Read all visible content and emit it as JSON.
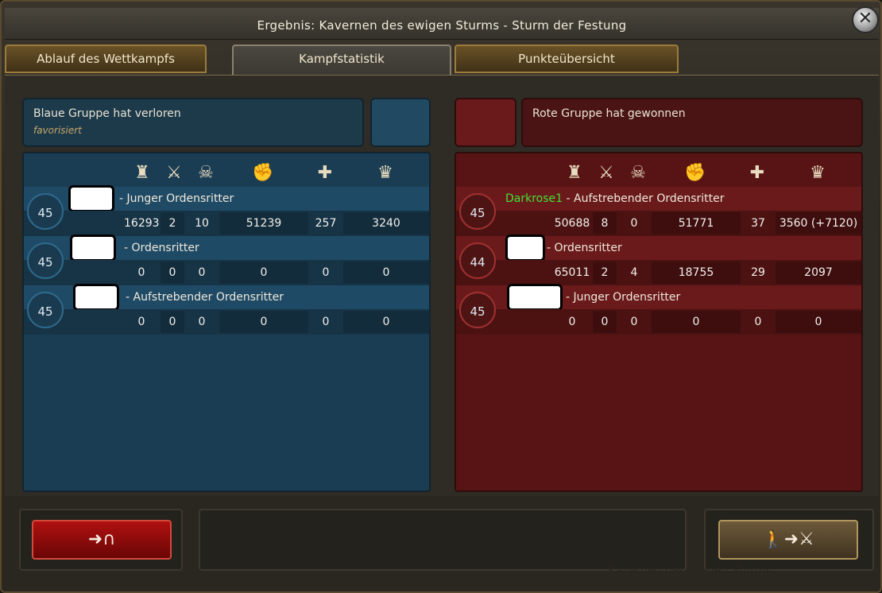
{
  "title": "Ergebnis: Kavernen des ewigen Sturms - Sturm der Festung",
  "tabs": [
    {
      "label": "Ablauf des Wettkampfs"
    },
    {
      "label": "Kampfstatistik"
    },
    {
      "label": "Punkteübersicht"
    }
  ],
  "blue": {
    "status": "Blaue Gruppe hat verloren",
    "sub": "favorisiert",
    "color": "#1b3d53",
    "players": [
      {
        "level": "45",
        "name": "",
        "title": "Junger Ordensritter",
        "stats": [
          "16293",
          "2",
          "10",
          "51239",
          "257",
          "3240"
        ]
      },
      {
        "level": "45",
        "name": "",
        "title": "Ordensritter",
        "stats": [
          "0",
          "0",
          "0",
          "0",
          "0",
          "0"
        ]
      },
      {
        "level": "45",
        "name": "",
        "title": "Aufstrebender Ordensritter",
        "stats": [
          "0",
          "0",
          "0",
          "0",
          "0",
          "0"
        ]
      }
    ]
  },
  "red": {
    "status": "Rote Gruppe hat gewonnen",
    "color": "#581414",
    "players": [
      {
        "level": "45",
        "name": "Darkrose1",
        "title": "Aufstrebender Ordensritter",
        "stats": [
          "50688",
          "8",
          "0",
          "51771",
          "37",
          "3560 (+7120)"
        ]
      },
      {
        "level": "44",
        "name": "",
        "title": "Ordensritter",
        "stats": [
          "65011",
          "2",
          "4",
          "18755",
          "29",
          "2097"
        ]
      },
      {
        "level": "45",
        "name": "",
        "title": "Junger Ordensritter",
        "stats": [
          "0",
          "0",
          "0",
          "0",
          "0",
          "0"
        ]
      }
    ]
  },
  "stat_icons": [
    "tower-icon",
    "crossed-swords-icon",
    "skull-icon",
    "fist-icon",
    "plus-icon",
    "crown-icon"
  ],
  "footer": {
    "watermark": "Kavernen des ewigen Sturms"
  }
}
